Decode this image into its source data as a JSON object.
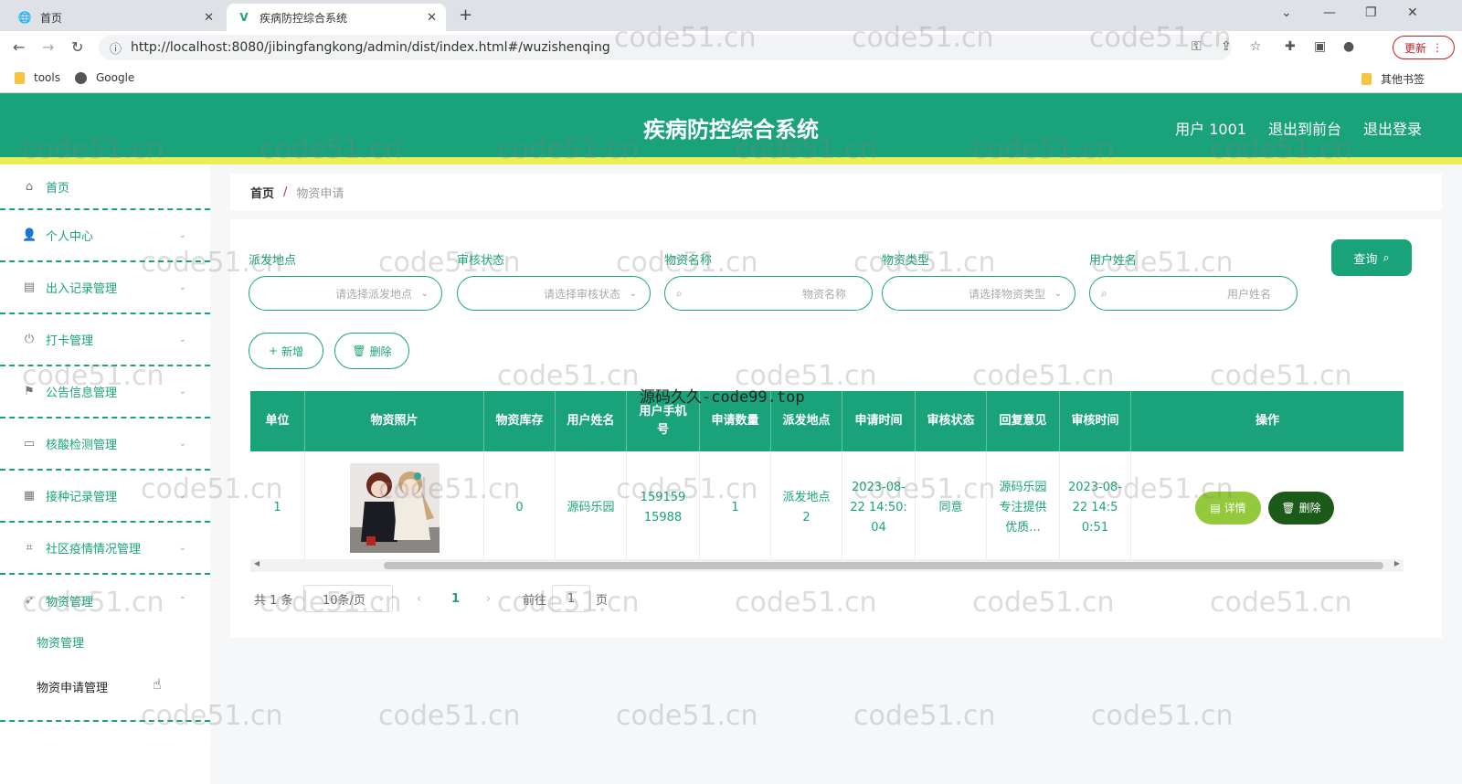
{
  "browser": {
    "tabs": [
      {
        "title": "首页"
      },
      {
        "title": "疾病防控综合系统"
      }
    ],
    "url": "http://localhost:8080/jibingfangkong/admin/dist/index.html#/wuzishenqing",
    "update_label": "更新",
    "bookmarks": [
      "tools",
      "Google"
    ],
    "other_bookmarks": "其他书签"
  },
  "header": {
    "title": "疾病防控综合系统",
    "links": [
      "用户 1001",
      "退出到前台",
      "退出登录"
    ]
  },
  "sidebar": {
    "items": [
      {
        "label": "首页"
      },
      {
        "label": "个人中心"
      },
      {
        "label": "出入记录管理"
      },
      {
        "label": "打卡管理"
      },
      {
        "label": "公告信息管理"
      },
      {
        "label": "核酸检测管理"
      },
      {
        "label": "接种记录管理"
      },
      {
        "label": "社区疫情情况管理"
      },
      {
        "label": "物资管理"
      }
    ],
    "subitems": [
      "物资管理",
      "物资申请管理"
    ]
  },
  "breadcrumb": {
    "home": "首页",
    "current": "物资申请"
  },
  "filters": [
    {
      "label": "派发地点",
      "placeholder": "请选择派发地点"
    },
    {
      "label": "审核状态",
      "placeholder": "请选择审核状态"
    },
    {
      "label": "物资名称",
      "placeholder": "物资名称"
    },
    {
      "label": "物资类型",
      "placeholder": "请选择物资类型"
    },
    {
      "label": "用户姓名",
      "placeholder": "用户姓名"
    }
  ],
  "buttons": {
    "query": "查询",
    "add": "新增",
    "delete": "删除"
  },
  "table": {
    "headers": [
      "单位",
      "物资照片",
      "物资库存",
      "用户姓名",
      "用户手机号",
      "申请数量",
      "派发地点",
      "申请时间",
      "审核状态",
      "回复意见",
      "审核时间",
      "操作"
    ],
    "row": {
      "unit": "1",
      "stock": "0",
      "user_name": "源码乐园",
      "phone": "15915915988",
      "quantity": "1",
      "location": "派发地点2",
      "apply_time": "2023-08-22 14:50:04",
      "status": "同意",
      "reply": "源码乐园专注提供优质...",
      "review_time": "2023-08-22 14:50:51",
      "detail_label": "详情",
      "delete_label": "删除"
    }
  },
  "pagination": {
    "total": "共 1 条",
    "page_size": "10条/页",
    "current_page": "1",
    "goto_prefix": "前往",
    "goto_value": "1",
    "goto_suffix": "页"
  },
  "watermarks": {
    "site": "code51.cn",
    "overlay": "源码久久-code99.top"
  }
}
